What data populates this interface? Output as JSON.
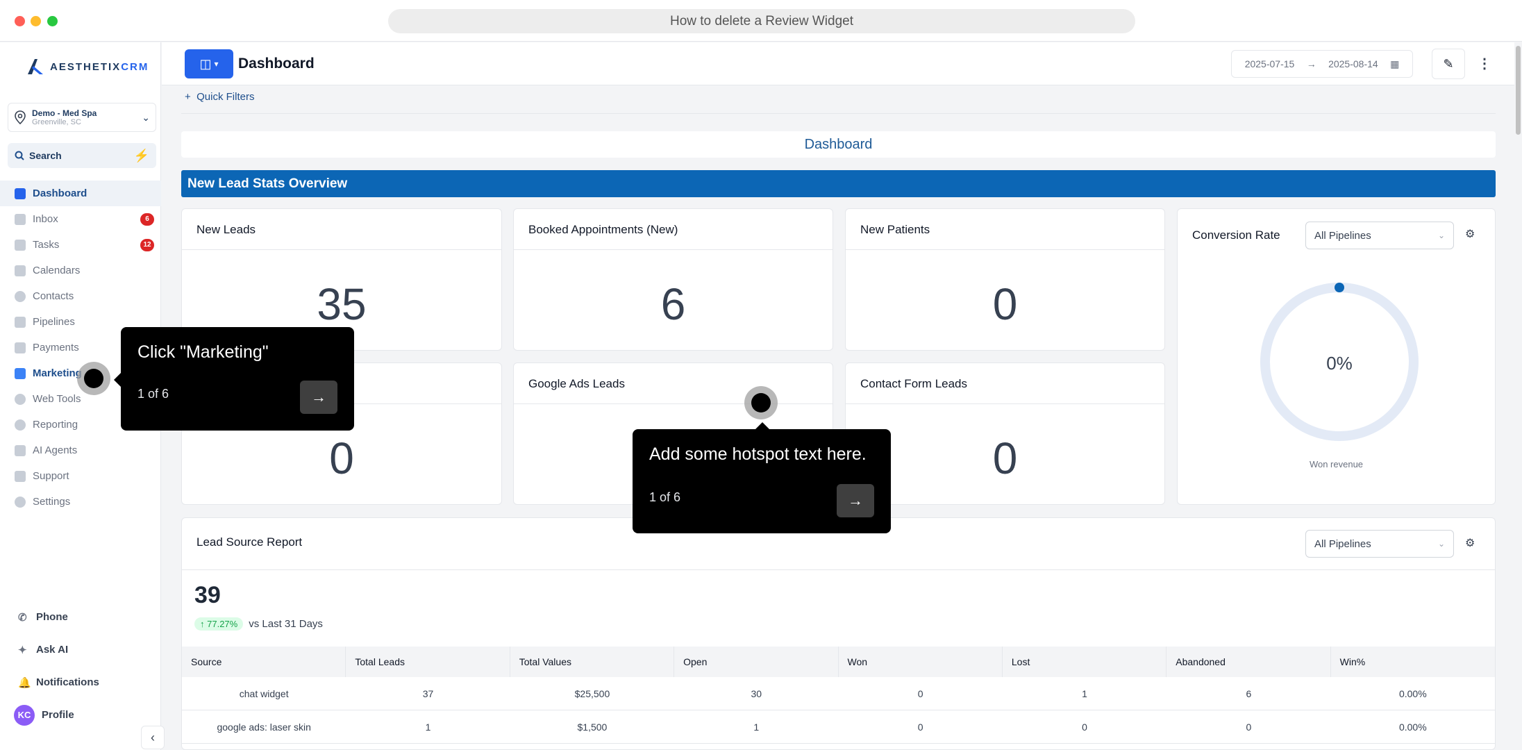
{
  "window": {
    "title": "How to delete a Review Widget"
  },
  "sidebar": {
    "logo": {
      "brand": "AESTHETIX",
      "suffix": "CRM"
    },
    "location": {
      "name": "Demo - Med Spa",
      "city": "Greenville, SC"
    },
    "search": {
      "label": "Search"
    },
    "items": [
      {
        "label": "Dashboard",
        "icon": "grid-icon",
        "active": true
      },
      {
        "label": "Inbox",
        "icon": "inbox-icon",
        "badge": "6"
      },
      {
        "label": "Tasks",
        "icon": "check-icon",
        "badge": "12"
      },
      {
        "label": "Calendars",
        "icon": "calendar-icon"
      },
      {
        "label": "Contacts",
        "icon": "user-icon"
      },
      {
        "label": "Pipelines",
        "icon": "filter-icon"
      },
      {
        "label": "Payments",
        "icon": "card-icon"
      },
      {
        "label": "Marketing",
        "icon": "megaphone-icon"
      },
      {
        "label": "Web Tools",
        "icon": "globe-icon"
      },
      {
        "label": "Reporting",
        "icon": "pie-icon"
      },
      {
        "label": "AI Agents",
        "icon": "robot-icon"
      },
      {
        "label": "Support",
        "icon": "chat-icon"
      },
      {
        "label": "Settings",
        "icon": "gear-icon"
      }
    ],
    "bottom": {
      "phone": "Phone",
      "ask_ai": "Ask AI",
      "notifications": "Notifications",
      "profile": "Profile",
      "avatar_initials": "KC"
    }
  },
  "header": {
    "title": "Dashboard",
    "date_from": "2025-07-15",
    "date_to": "2025-08-14"
  },
  "main": {
    "quick_filters": "Quick Filters",
    "dashboard_title": "Dashboard",
    "section_title": "New Lead Stats Overview",
    "cards": {
      "new_leads": {
        "title": "New Leads",
        "value": "35"
      },
      "booked": {
        "title": "Booked Appointments (New)",
        "value": "6"
      },
      "new_patients": {
        "title": "New Patients",
        "value": "0"
      },
      "card4": {
        "title": "",
        "value": "0"
      },
      "google_ads": {
        "title": "Google Ads Leads",
        "value": ""
      },
      "contact_form": {
        "title": "Contact Form Leads",
        "value": "0"
      }
    },
    "conversion": {
      "title": "Conversion Rate",
      "select": "All Pipelines",
      "value": "0%",
      "caption": "Won revenue",
      "fraction": 0
    },
    "lead_report": {
      "title": "Lead Source Report",
      "select": "All Pipelines",
      "total": "39",
      "change": "77.27%",
      "change_label": "vs Last 31 Days",
      "columns": [
        "Source",
        "Total Leads",
        "Total Values",
        "Open",
        "Won",
        "Lost",
        "Abandoned",
        "Win%"
      ],
      "rows": [
        [
          "chat widget",
          "37",
          "$25,500",
          "30",
          "0",
          "1",
          "6",
          "0.00%"
        ],
        [
          "google ads: laser skin",
          "1",
          "$1,500",
          "1",
          "0",
          "0",
          "0",
          "0.00%"
        ]
      ]
    }
  },
  "tooltips": {
    "marketing": {
      "text": "Click \"Marketing\"",
      "step": "1 of 6"
    },
    "hotspot": {
      "text": "Add some hotspot text here.",
      "step": "1 of 6"
    }
  },
  "colors": {
    "accent": "#2563eb",
    "section": "#0c66b5",
    "badge": "#dc2626"
  }
}
